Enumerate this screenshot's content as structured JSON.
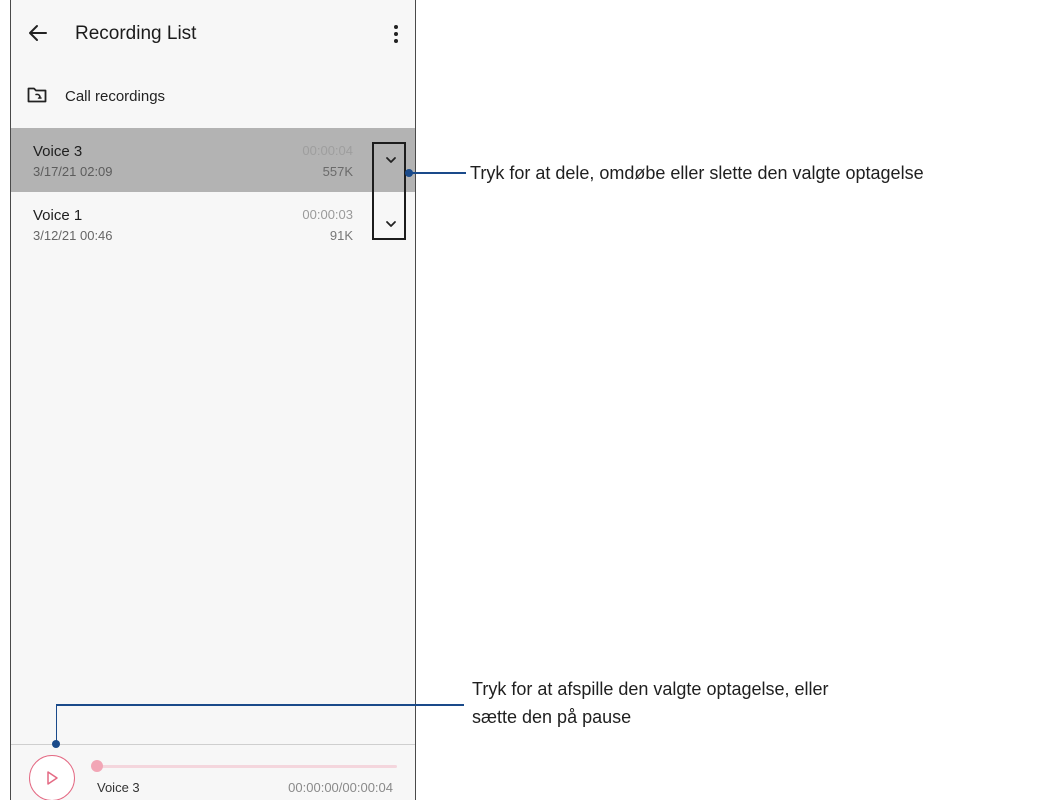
{
  "app": {
    "title": "Recording List",
    "back_icon": "back-arrow-icon",
    "more_icon": "more-vert-icon"
  },
  "folder": {
    "icon": "call-recording-folder-icon",
    "label": "Call recordings"
  },
  "recordings": [
    {
      "name": "Voice 3",
      "date": "3/17/21 02:09",
      "duration": "00:00:04",
      "size": "557K",
      "selected": true
    },
    {
      "name": "Voice 1",
      "date": "3/12/21 00:46",
      "duration": "00:00:03",
      "size": "91K",
      "selected": false
    }
  ],
  "player": {
    "track": "Voice 3",
    "time": "00:00:00/00:00:04",
    "progress": 0,
    "play_icon": "play-icon",
    "accent": "#e46a84"
  },
  "annotations": {
    "expand": "Tryk for at dele, omdøbe eller slette den valgte optagelse",
    "play_line1": "Tryk for at afspille den valgte optagelse, eller",
    "play_line2": "sætte den på pause",
    "callout_color": "#1a4a8a"
  }
}
